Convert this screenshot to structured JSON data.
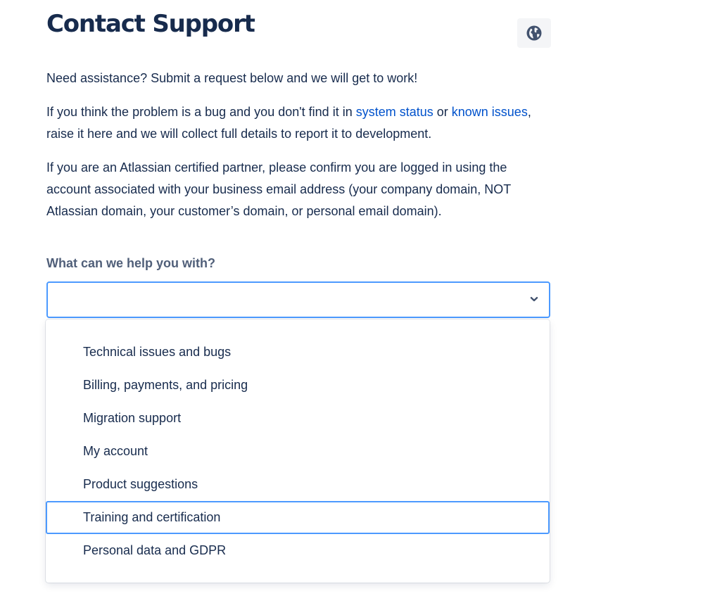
{
  "header": {
    "title": "Contact Support",
    "language_icon": "globe-icon"
  },
  "intro": {
    "p1": "Need assistance? Submit a request below and we will get to work!",
    "p2": {
      "before": "If you think the problem is a bug and you don't find it in ",
      "link1": "system status",
      "middle": " or ",
      "link2": "known issues",
      "after": ", raise it here and we will collect full details to report it to development."
    },
    "p3": "If you are an Atlassian certified partner, please confirm you are logged in using the account associated with your business email address (your company domain, NOT Atlassian domain, your customer’s domain, or personal email domain)."
  },
  "form": {
    "label": "What can we help you with?",
    "selected_value": "",
    "dropdown_icon": "chevron-down-icon",
    "options": [
      {
        "label": "Technical issues and bugs"
      },
      {
        "label": "Billing, payments, and pricing"
      },
      {
        "label": "Migration support"
      },
      {
        "label": "My account"
      },
      {
        "label": "Product suggestions"
      },
      {
        "label": "Training and certification"
      },
      {
        "label": "Personal data and GDPR"
      }
    ],
    "focused_option": "Training and certification"
  },
  "colors": {
    "text": "#172b4d",
    "label": "#505f79",
    "link": "#0052cc",
    "focus": "#4c9aff",
    "button_bg": "#f4f5f7"
  }
}
